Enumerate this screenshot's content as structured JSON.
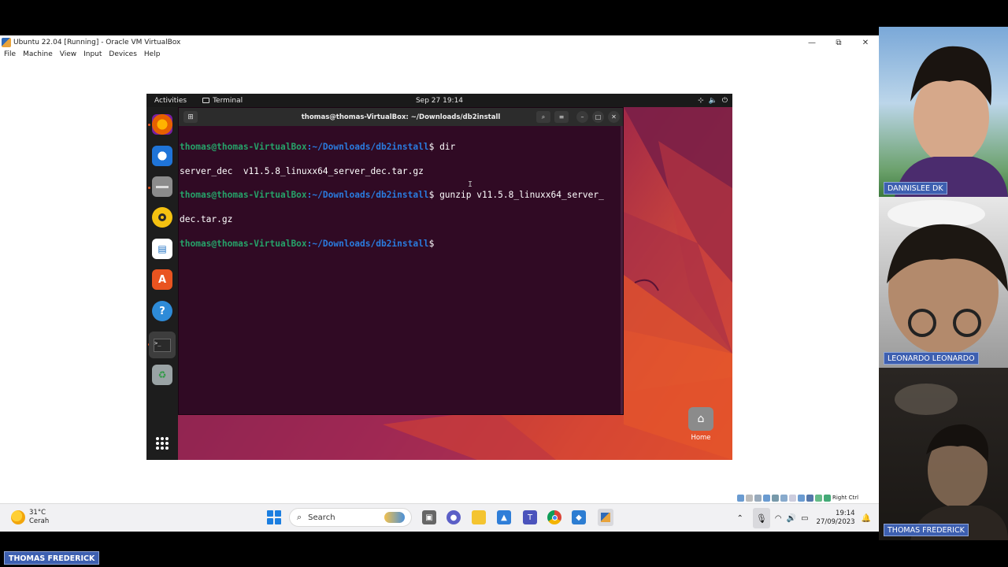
{
  "host_window": {
    "title": "Ubuntu 22.04 [Running] - Oracle VM VirtualBox",
    "menu": [
      "File",
      "Machine",
      "View",
      "Input",
      "Devices",
      "Help"
    ],
    "controls": {
      "minimize": "—",
      "maximize": "⧉",
      "close": "✕"
    },
    "status_strip_label": "Right Ctrl"
  },
  "guest": {
    "topbar": {
      "activities": "Activities",
      "app": "Terminal",
      "clock": "Sep 27  19:14"
    },
    "status_icons": [
      "network-icon",
      "volume-icon",
      "power-icon"
    ],
    "dock": [
      {
        "name": "firefox-icon",
        "glyph": "🦊",
        "running": true
      },
      {
        "name": "thunderbird-icon",
        "glyph": "✉",
        "running": false
      },
      {
        "name": "files-icon",
        "glyph": "▬",
        "running": true
      },
      {
        "name": "rhythmbox-icon",
        "glyph": "◉",
        "running": false
      },
      {
        "name": "writer-icon",
        "glyph": "▤",
        "running": false
      },
      {
        "name": "appcenter-icon",
        "glyph": "A",
        "running": false
      },
      {
        "name": "help-icon",
        "glyph": "?",
        "running": false
      },
      {
        "name": "terminal-icon",
        "glyph": ">_",
        "running": true
      },
      {
        "name": "trash-icon",
        "glyph": "♻",
        "running": false
      }
    ],
    "show_apps_glyph": "⠿",
    "terminal": {
      "title": "thomas@thomas-VirtualBox: ~/Downloads/db2install",
      "prompt_user": "thomas@thomas-VirtualBox",
      "prompt_path": ":~/Downloads/db2install",
      "prompt_symbol": "$",
      "lines": [
        {
          "type": "prompt",
          "cmd": " dir"
        },
        {
          "type": "output",
          "text": "server_dec  v11.5.8_linuxx64_server_dec.tar.gz"
        },
        {
          "type": "prompt",
          "cmd": " gunzip v11.5.8_linuxx64_server_"
        },
        {
          "type": "output",
          "text": "dec.tar.gz"
        },
        {
          "type": "prompt",
          "cmd": " "
        }
      ]
    },
    "desktop_home_label": "Home"
  },
  "taskbar": {
    "weather_temp": "31°C",
    "weather_desc": "Cerah",
    "search_placeholder": "Search",
    "time": "19:14",
    "date": "27/09/2023"
  },
  "presenter_tag": "THOMAS FREDERICK",
  "participants": [
    {
      "name": "DANNISLEE DK"
    },
    {
      "name": "LEONARDO LEONARDO"
    },
    {
      "name": "THOMAS FREDERICK"
    }
  ],
  "colors": {
    "ubuntu_orange": "#e95420",
    "terminal_bg": "#300a24",
    "prompt_green": "#26a269",
    "prompt_blue": "#2a7bde",
    "name_tag_blue": "#3d5fb0"
  }
}
